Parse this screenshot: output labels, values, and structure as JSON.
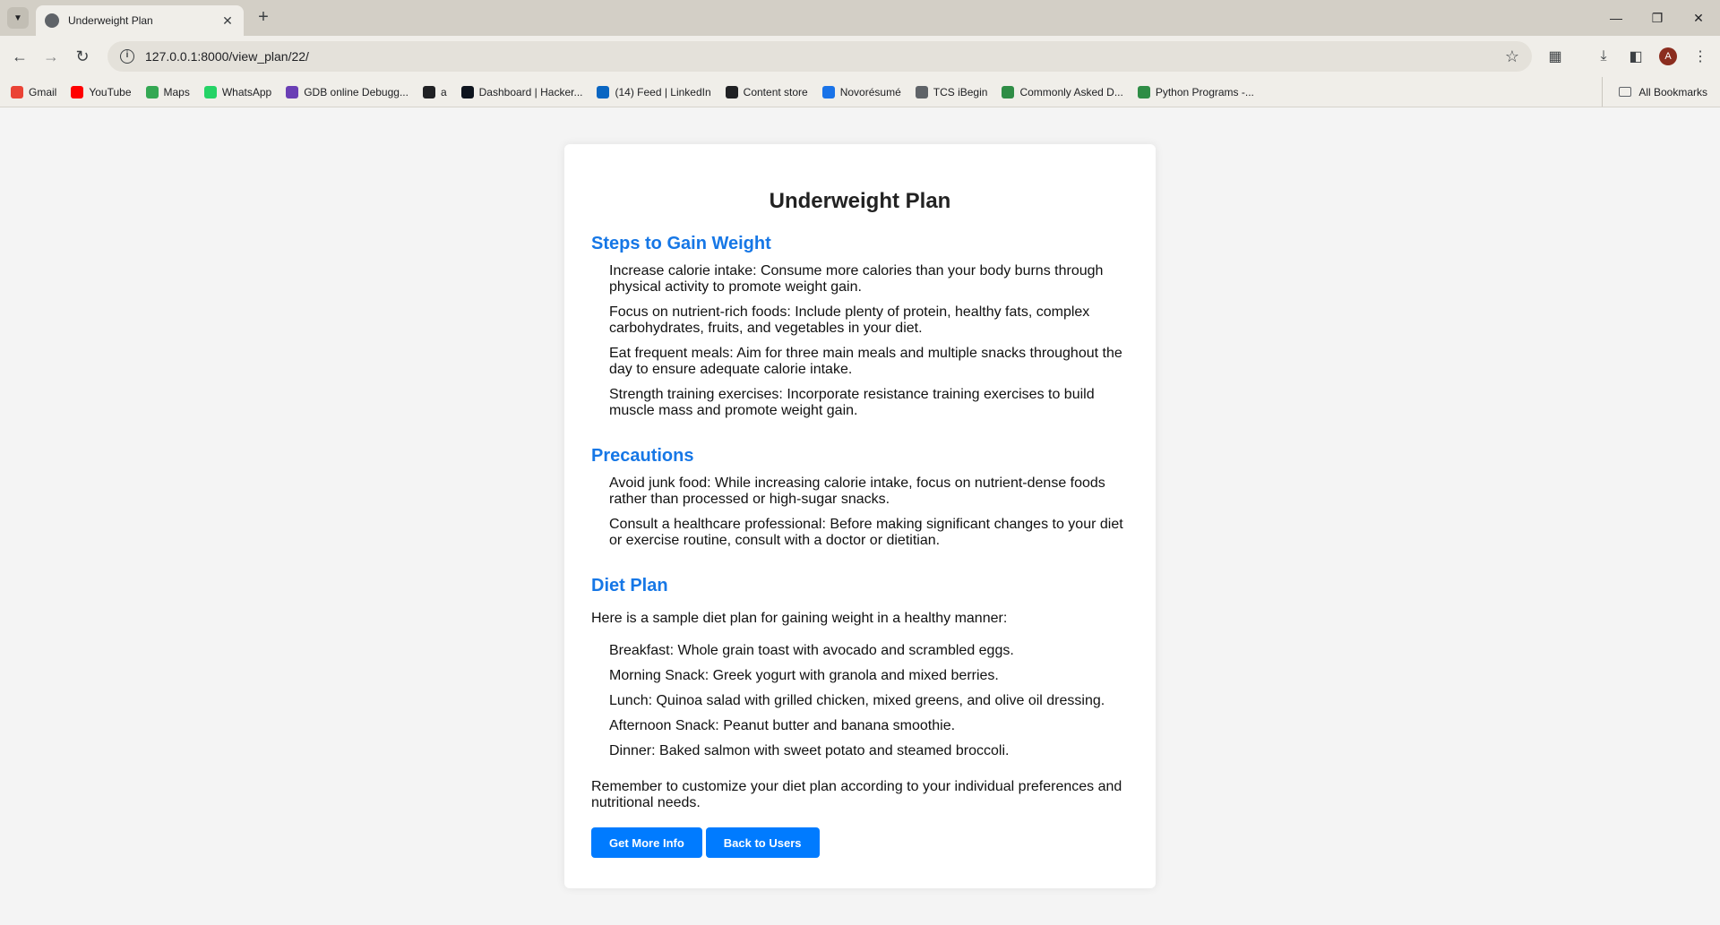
{
  "browser": {
    "tab_title": "Underweight Plan",
    "url": "127.0.0.1:8000/view_plan/22/",
    "avatar_letter": "A",
    "bookmarks": [
      {
        "label": "Gmail",
        "color": "#ea4335"
      },
      {
        "label": "YouTube",
        "color": "#ff0000"
      },
      {
        "label": "Maps",
        "color": "#34a853"
      },
      {
        "label": "WhatsApp",
        "color": "#25d366"
      },
      {
        "label": "GDB online Debugg...",
        "color": "#6a3fb5"
      },
      {
        "label": "a",
        "color": "#202124"
      },
      {
        "label": "Dashboard | Hacker...",
        "color": "#0e141e"
      },
      {
        "label": "(14) Feed | LinkedIn",
        "color": "#0a66c2"
      },
      {
        "label": "Content store",
        "color": "#202124"
      },
      {
        "label": "Novorésumé",
        "color": "#1a73e8"
      },
      {
        "label": "TCS iBegin",
        "color": "#5f6368"
      },
      {
        "label": "Commonly Asked D...",
        "color": "#2f8d46"
      },
      {
        "label": "Python Programs -...",
        "color": "#2f8d46"
      }
    ],
    "all_bookmarks": "All Bookmarks"
  },
  "page": {
    "title": "Underweight Plan",
    "steps_heading": "Steps to Gain Weight",
    "steps": [
      "Increase calorie intake: Consume more calories than your body burns through physical activity to promote weight gain.",
      "Focus on nutrient-rich foods: Include plenty of protein, healthy fats, complex carbohydrates, fruits, and vegetables in your diet.",
      "Eat frequent meals: Aim for three main meals and multiple snacks throughout the day to ensure adequate calorie intake.",
      "Strength training exercises: Incorporate resistance training exercises to build muscle mass and promote weight gain."
    ],
    "precautions_heading": "Precautions",
    "precautions": [
      "Avoid junk food: While increasing calorie intake, focus on nutrient-dense foods rather than processed or high-sugar snacks.",
      "Consult a healthcare professional: Before making significant changes to your diet or exercise routine, consult with a doctor or dietitian."
    ],
    "diet_heading": "Diet Plan",
    "diet_intro": "Here is a sample diet plan for gaining weight in a healthy manner:",
    "diet_items": [
      "Breakfast: Whole grain toast with avocado and scrambled eggs.",
      "Morning Snack: Greek yogurt with granola and mixed berries.",
      "Lunch: Quinoa salad with grilled chicken, mixed greens, and olive oil dressing.",
      "Afternoon Snack: Peanut butter and banana smoothie.",
      "Dinner: Baked salmon with sweet potato and steamed broccoli."
    ],
    "diet_outro": "Remember to customize your diet plan according to your individual preferences and nutritional needs.",
    "buttons": {
      "more_info": "Get More Info",
      "back": "Back to Users"
    }
  }
}
